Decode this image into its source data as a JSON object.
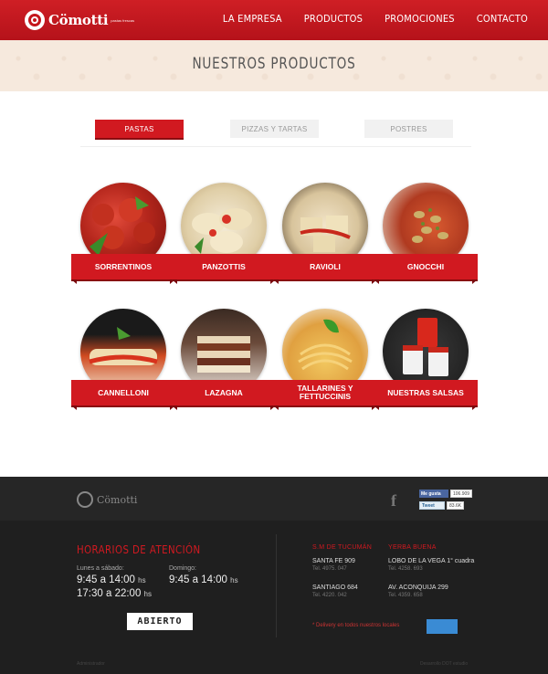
{
  "header": {
    "brand": "Cömotti",
    "brand_tagline": "pastas frescas",
    "nav": [
      "LA EMPRESA",
      "PRODUCTOS",
      "PROMOCIONES",
      "CONTACTO"
    ]
  },
  "page_title": "NUESTROS PRODUCTOS",
  "tabs": [
    "PASTAS",
    "PIZZAS Y TARTAS",
    "POSTRES"
  ],
  "products": [
    {
      "name": "SORRENTINOS",
      "color": "#b4261c"
    },
    {
      "name": "PANZOTTIS",
      "color": "#e9dcc2"
    },
    {
      "name": "RAVIOLI",
      "color": "#e6d7b8"
    },
    {
      "name": "GNOCCHI",
      "color": "#c24a2a"
    },
    {
      "name": "CANNELLONI",
      "color": "#d04a20"
    },
    {
      "name": "LAZAGNA",
      "color": "#8a4a2a"
    },
    {
      "name": "TALLARINES Y FETTUCCINIS",
      "color": "#e6b348"
    },
    {
      "name": "NUESTRAS SALSAS",
      "color": "#2a2a2a"
    }
  ],
  "footer": {
    "brand": "Cömotti",
    "facebook_icon": "facebook-icon",
    "like_label": "Me gusta",
    "like_count": "106.909",
    "tweet_label": "Tweet",
    "tweet_count": "83.6K",
    "hours_title": "HORARIOS DE ATENCIÓN",
    "weekday_label": "Lunes a sábado:",
    "weekday_hours_1": "9:45 a 14:00",
    "weekday_hours_2": "17:30 a 22:00",
    "sunday_label": "Domingo:",
    "sunday_hours": "9:45 a 14:00",
    "hours_unit": "hs",
    "status": "ABIERTO",
    "locations": [
      {
        "city": "S.M DE TUCUMÁN",
        "shops": [
          {
            "address": "SANTA FE 909",
            "tel": "Tel. 4975. 047"
          },
          {
            "address": "SANTIAGO 684",
            "tel": "Tel. 4220. 042"
          }
        ]
      },
      {
        "city": "YERBA BUENA",
        "shops": [
          {
            "address": "LOBO DE LA VEGA 1° cuadra",
            "tel": "Tel. 4258. 693"
          },
          {
            "address": "AV. ACONQUIJA 299",
            "tel": "Tel. 4359. 658"
          }
        ]
      }
    ],
    "delivery_note": "* Delivery en todos nuestros locales",
    "admin_link": "Administrador",
    "credit": "Desarrollo DOT estudio"
  },
  "colors": {
    "brand_red": "#d11920",
    "footer_bg": "#1f1f1f"
  }
}
